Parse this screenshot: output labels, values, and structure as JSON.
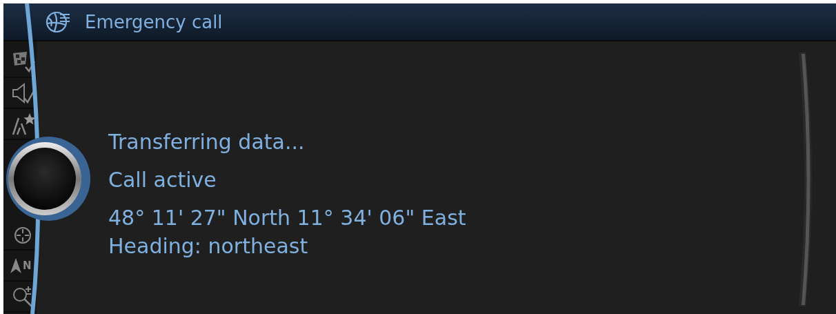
{
  "window": {
    "title": "Emergency call"
  },
  "sidebar": {
    "top_items": [
      {
        "kind": "flag"
      },
      {
        "kind": "speaker"
      },
      {
        "kind": "road"
      }
    ],
    "bottom_items": [
      {
        "kind": "crosshair"
      },
      {
        "kind": "north",
        "label": "N"
      },
      {
        "kind": "zoom"
      }
    ]
  },
  "status_lines": [
    "Transferring data...",
    "Call active"
  ],
  "position": {
    "coordinates": "48° 11' 27\" North 11° 34' 06\" East",
    "heading": "Heading: northeast"
  }
}
